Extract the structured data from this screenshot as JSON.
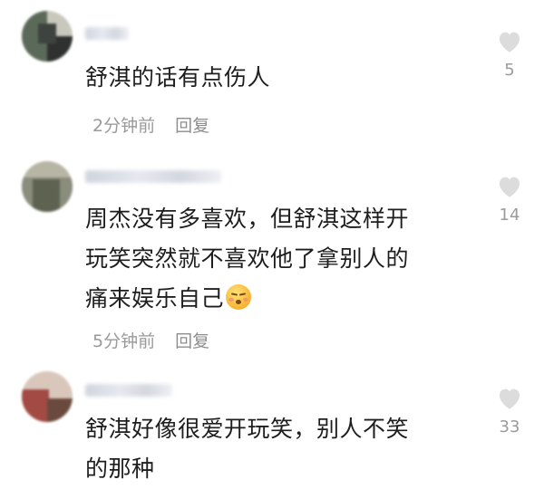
{
  "comments": [
    {
      "text_lines": [
        "舒淇的话有点伤人"
      ],
      "time": "2分钟前",
      "reply_label": "回复",
      "likes": "5",
      "avatar_colors": [
        "#5b6a58",
        "#c9c8bd",
        "#2f3130"
      ]
    },
    {
      "text_lines": [
        "周杰没有多喜欢，但舒淇这样开",
        "玩笑突然就不喜欢他了拿别人的",
        "痛来娱乐自己"
      ],
      "emoji": "pleading-face-icon",
      "time": "5分钟前",
      "reply_label": "回复",
      "likes": "14",
      "avatar_colors": [
        "#8a8c7c",
        "#5d6350",
        "#b7b5a4"
      ]
    },
    {
      "text_lines": [
        "舒淇好像很爱开玩笑，别人不笑",
        "的那种"
      ],
      "likes": "33",
      "avatar_colors": [
        "#a24a43",
        "#d9c7bb",
        "#6b4a3e"
      ]
    }
  ],
  "colors": {
    "text": "#1e1e1e",
    "meta": "#9a9a9a",
    "heart": "#dcdcdc"
  }
}
